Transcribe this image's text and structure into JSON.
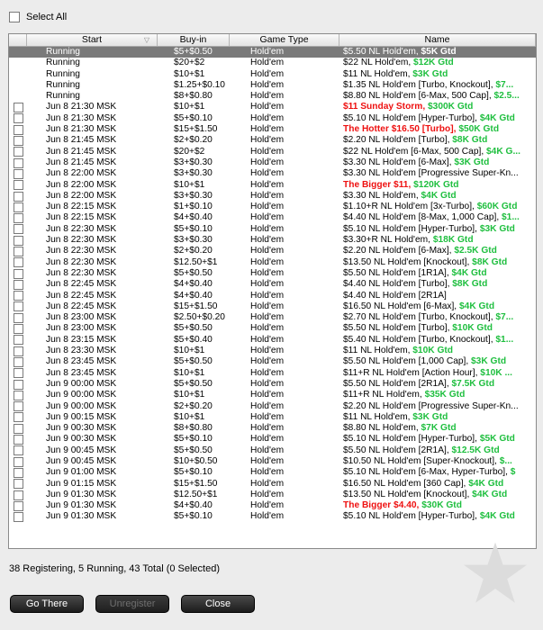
{
  "select_all_label": "Select All",
  "columns": {
    "start": "Start",
    "buyin": "Buy-in",
    "game": "Game Type",
    "name": "Name"
  },
  "rows": [
    {
      "start": "Running",
      "buyin": "$5+$0.50",
      "game": "Hold'em",
      "name": "$5.50 NL Hold'em, ",
      "gtd": "$5K Gtd",
      "red": false,
      "checkbox": false,
      "selected": true
    },
    {
      "start": "Running",
      "buyin": "$20+$2",
      "game": "Hold'em",
      "name": "$22 NL Hold'em, ",
      "gtd": "$12K Gtd",
      "red": false,
      "checkbox": false
    },
    {
      "start": "Running",
      "buyin": "$10+$1",
      "game": "Hold'em",
      "name": "$11 NL Hold'em, ",
      "gtd": "$3K Gtd",
      "red": false,
      "checkbox": false
    },
    {
      "start": "Running",
      "buyin": "$1.25+$0.10",
      "game": "Hold'em",
      "name": "$1.35 NL Hold'em [Turbo, Knockout], ",
      "gtd": "$7...",
      "red": false,
      "checkbox": false
    },
    {
      "start": "Running",
      "buyin": "$8+$0.80",
      "game": "Hold'em",
      "name": "$8.80 NL Hold'em [6-Max, 500 Cap], ",
      "gtd": "$2.5...",
      "red": false,
      "checkbox": false
    },
    {
      "start": "Jun 8  21:30 MSK",
      "buyin": "$10+$1",
      "game": "Hold'em",
      "name": "$11 Sunday Storm, ",
      "gtd": "$300K Gtd",
      "red": true,
      "checkbox": true
    },
    {
      "start": "Jun 8  21:30 MSK",
      "buyin": "$5+$0.10",
      "game": "Hold'em",
      "name": "$5.10 NL Hold'em [Hyper-Turbo], ",
      "gtd": "$4K Gtd",
      "red": false,
      "checkbox": true
    },
    {
      "start": "Jun 8  21:30 MSK",
      "buyin": "$15+$1.50",
      "game": "Hold'em",
      "name": "The Hotter $16.50 [Turbo], ",
      "gtd": "$50K Gtd",
      "red": true,
      "checkbox": true
    },
    {
      "start": "Jun 8  21:45 MSK",
      "buyin": "$2+$0.20",
      "game": "Hold'em",
      "name": "$2.20 NL Hold'em [Turbo], ",
      "gtd": "$8K Gtd",
      "red": false,
      "checkbox": true
    },
    {
      "start": "Jun 8  21:45 MSK",
      "buyin": "$20+$2",
      "game": "Hold'em",
      "name": "$22 NL Hold'em [6-Max, 500 Cap], ",
      "gtd": "$4K G...",
      "red": false,
      "checkbox": true
    },
    {
      "start": "Jun 8  21:45 MSK",
      "buyin": "$3+$0.30",
      "game": "Hold'em",
      "name": "$3.30 NL Hold'em [6-Max], ",
      "gtd": "$3K Gtd",
      "red": false,
      "checkbox": true
    },
    {
      "start": "Jun 8  22:00 MSK",
      "buyin": "$3+$0.30",
      "game": "Hold'em",
      "name": "$3.30 NL Hold'em [Progressive Super-Kn...",
      "gtd": "",
      "red": false,
      "checkbox": true
    },
    {
      "start": "Jun 8  22:00 MSK",
      "buyin": "$10+$1",
      "game": "Hold'em",
      "name": "The Bigger $11, ",
      "gtd": "$120K Gtd",
      "red": true,
      "checkbox": true
    },
    {
      "start": "Jun 8  22:00 MSK",
      "buyin": "$3+$0.30",
      "game": "Hold'em",
      "name": "$3.30 NL Hold'em, ",
      "gtd": "$4K Gtd",
      "red": false,
      "checkbox": true
    },
    {
      "start": "Jun 8  22:15 MSK",
      "buyin": "$1+$0.10",
      "game": "Hold'em",
      "name": "$1.10+R NL Hold'em [3x-Turbo], ",
      "gtd": "$60K Gtd",
      "red": false,
      "checkbox": true
    },
    {
      "start": "Jun 8  22:15 MSK",
      "buyin": "$4+$0.40",
      "game": "Hold'em",
      "name": "$4.40 NL Hold'em [8-Max, 1,000 Cap], ",
      "gtd": "$1...",
      "red": false,
      "checkbox": true
    },
    {
      "start": "Jun 8  22:30 MSK",
      "buyin": "$5+$0.10",
      "game": "Hold'em",
      "name": "$5.10 NL Hold'em [Hyper-Turbo], ",
      "gtd": "$3K Gtd",
      "red": false,
      "checkbox": true
    },
    {
      "start": "Jun 8  22:30 MSK",
      "buyin": "$3+$0.30",
      "game": "Hold'em",
      "name": "$3.30+R NL Hold'em, ",
      "gtd": "$18K Gtd",
      "red": false,
      "checkbox": true
    },
    {
      "start": "Jun 8  22:30 MSK",
      "buyin": "$2+$0.20",
      "game": "Hold'em",
      "name": "$2.20 NL Hold'em [6-Max], ",
      "gtd": "$2.5K Gtd",
      "red": false,
      "checkbox": true
    },
    {
      "start": "Jun 8  22:30 MSK",
      "buyin": "$12.50+$1",
      "game": "Hold'em",
      "name": "$13.50 NL Hold'em [Knockout], ",
      "gtd": "$8K Gtd",
      "red": false,
      "checkbox": true
    },
    {
      "start": "Jun 8  22:30 MSK",
      "buyin": "$5+$0.50",
      "game": "Hold'em",
      "name": "$5.50 NL Hold'em [1R1A], ",
      "gtd": "$4K Gtd",
      "red": false,
      "checkbox": true
    },
    {
      "start": "Jun 8  22:45 MSK",
      "buyin": "$4+$0.40",
      "game": "Hold'em",
      "name": "$4.40 NL Hold'em [Turbo], ",
      "gtd": "$8K Gtd",
      "red": false,
      "checkbox": true
    },
    {
      "start": "Jun 8  22:45 MSK",
      "buyin": "$4+$0.40",
      "game": "Hold'em",
      "name": "$4.40 NL Hold'em [2R1A]",
      "gtd": "",
      "red": false,
      "checkbox": true
    },
    {
      "start": "Jun 8  22:45 MSK",
      "buyin": "$15+$1.50",
      "game": "Hold'em",
      "name": "$16.50 NL Hold'em [6-Max], ",
      "gtd": "$4K Gtd",
      "red": false,
      "checkbox": true
    },
    {
      "start": "Jun 8  23:00 MSK",
      "buyin": "$2.50+$0.20",
      "game": "Hold'em",
      "name": "$2.70 NL Hold'em [Turbo, Knockout], ",
      "gtd": "$7...",
      "red": false,
      "checkbox": true
    },
    {
      "start": "Jun 8  23:00 MSK",
      "buyin": "$5+$0.50",
      "game": "Hold'em",
      "name": "$5.50 NL Hold'em [Turbo], ",
      "gtd": "$10K Gtd",
      "red": false,
      "checkbox": true
    },
    {
      "start": "Jun 8  23:15 MSK",
      "buyin": "$5+$0.40",
      "game": "Hold'em",
      "name": "$5.40 NL Hold'em [Turbo, Knockout], ",
      "gtd": "$1...",
      "red": false,
      "checkbox": true
    },
    {
      "start": "Jun 8  23:30 MSK",
      "buyin": "$10+$1",
      "game": "Hold'em",
      "name": "$11 NL Hold'em, ",
      "gtd": "$10K Gtd",
      "red": false,
      "checkbox": true
    },
    {
      "start": "Jun 8  23:45 MSK",
      "buyin": "$5+$0.50",
      "game": "Hold'em",
      "name": "$5.50 NL Hold'em [1,000 Cap], ",
      "gtd": "$3K Gtd",
      "red": false,
      "checkbox": true
    },
    {
      "start": "Jun 8  23:45 MSK",
      "buyin": "$10+$1",
      "game": "Hold'em",
      "name": "$11+R NL Hold'em [Action Hour], ",
      "gtd": "$10K ...",
      "red": false,
      "checkbox": true
    },
    {
      "start": "Jun 9  00:00 MSK",
      "buyin": "$5+$0.50",
      "game": "Hold'em",
      "name": "$5.50 NL Hold'em [2R1A], ",
      "gtd": "$7.5K Gtd",
      "red": false,
      "checkbox": true
    },
    {
      "start": "Jun 9  00:00 MSK",
      "buyin": "$10+$1",
      "game": "Hold'em",
      "name": "$11+R NL Hold'em, ",
      "gtd": "$35K Gtd",
      "red": false,
      "checkbox": true
    },
    {
      "start": "Jun 9  00:00 MSK",
      "buyin": "$2+$0.20",
      "game": "Hold'em",
      "name": "$2.20 NL Hold'em [Progressive Super-Kn...",
      "gtd": "",
      "red": false,
      "checkbox": true
    },
    {
      "start": "Jun 9  00:15 MSK",
      "buyin": "$10+$1",
      "game": "Hold'em",
      "name": "$11 NL Hold'em, ",
      "gtd": "$3K Gtd",
      "red": false,
      "checkbox": true
    },
    {
      "start": "Jun 9  00:30 MSK",
      "buyin": "$8+$0.80",
      "game": "Hold'em",
      "name": "$8.80 NL Hold'em, ",
      "gtd": "$7K Gtd",
      "red": false,
      "checkbox": true
    },
    {
      "start": "Jun 9  00:30 MSK",
      "buyin": "$5+$0.10",
      "game": "Hold'em",
      "name": "$5.10 NL Hold'em [Hyper-Turbo], ",
      "gtd": "$5K Gtd",
      "red": false,
      "checkbox": true
    },
    {
      "start": "Jun 9  00:45 MSK",
      "buyin": "$5+$0.50",
      "game": "Hold'em",
      "name": "$5.50 NL Hold'em [2R1A], ",
      "gtd": "$12.5K Gtd",
      "red": false,
      "checkbox": true
    },
    {
      "start": "Jun 9  00:45 MSK",
      "buyin": "$10+$0.50",
      "game": "Hold'em",
      "name": "$10.50 NL Hold'em [Super-Knockout], ",
      "gtd": "$...",
      "red": false,
      "checkbox": true
    },
    {
      "start": "Jun 9  01:00 MSK",
      "buyin": "$5+$0.10",
      "game": "Hold'em",
      "name": "$5.10 NL Hold'em [6-Max, Hyper-Turbo], ",
      "gtd": "$",
      "red": false,
      "checkbox": true
    },
    {
      "start": "Jun 9  01:15 MSK",
      "buyin": "$15+$1.50",
      "game": "Hold'em",
      "name": "$16.50 NL Hold'em [360 Cap], ",
      "gtd": "$4K Gtd",
      "red": false,
      "checkbox": true
    },
    {
      "start": "Jun 9  01:30 MSK",
      "buyin": "$12.50+$1",
      "game": "Hold'em",
      "name": "$13.50 NL Hold'em [Knockout], ",
      "gtd": "$4K Gtd",
      "red": false,
      "checkbox": true
    },
    {
      "start": "Jun 9  01:30 MSK",
      "buyin": "$4+$0.40",
      "game": "Hold'em",
      "name": "The Bigger $4.40, ",
      "gtd": "$30K Gtd",
      "red": true,
      "checkbox": true
    },
    {
      "start": "Jun 9  01:30 MSK",
      "buyin": "$5+$0.10",
      "game": "Hold'em",
      "name": "$5.10 NL Hold'em [Hyper-Turbo], ",
      "gtd": "$4K Gtd",
      "red": false,
      "checkbox": true
    }
  ],
  "status_text": "38 Registering, 5 Running, 43 Total (0 Selected)",
  "buttons": {
    "go_there": "Go There",
    "unregister": "Unregister",
    "close": "Close"
  },
  "colors": {
    "selected_row": "#7a7a7a",
    "gtd_green": "#1fbf3f",
    "featured_red": "#ee1111",
    "button_dark": "#1c1c1c"
  },
  "icons": {
    "sort": "sort-descending-icon",
    "logo": "pokerstars-star-logo-icon"
  }
}
